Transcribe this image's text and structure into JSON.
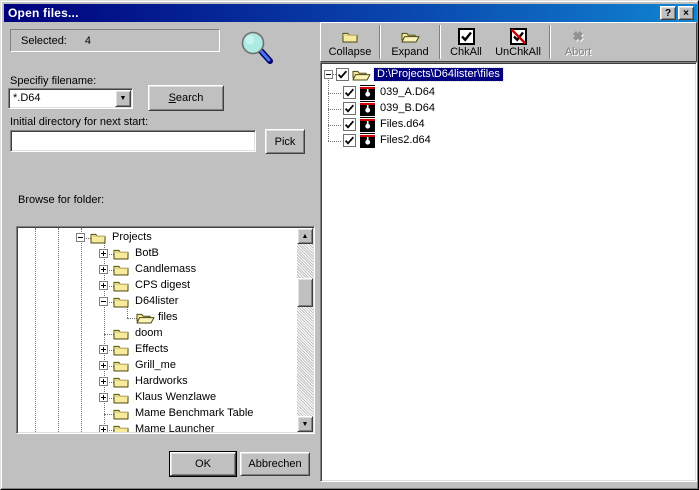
{
  "window": {
    "title": "Open files...",
    "help_button": "?",
    "close_button": "×"
  },
  "left": {
    "selected_label": "Selected:",
    "selected_value": "4",
    "filename_label": "Specifiy filename:",
    "filename_value": "*.D64",
    "search_button": "Search",
    "initial_dir_label": "Initial directory for next start:",
    "initial_dir_value": "",
    "pick_button": "Pick",
    "browse_label": "Browse for folder:",
    "ok_button": "OK",
    "cancel_button": "Abbrechen",
    "folder_tree": [
      {
        "label": "Projects",
        "indent": 2,
        "box": "minus",
        "icon": "folder-closed"
      },
      {
        "label": "BotB",
        "indent": 3,
        "box": "plus",
        "icon": "folder-closed"
      },
      {
        "label": "Candlemass",
        "indent": 3,
        "box": "plus",
        "icon": "folder-closed"
      },
      {
        "label": "CPS digest",
        "indent": 3,
        "box": "plus",
        "icon": "folder-closed"
      },
      {
        "label": "D64lister",
        "indent": 3,
        "box": "minus",
        "icon": "folder-closed"
      },
      {
        "label": "files",
        "indent": 4,
        "box": "none",
        "icon": "folder-open"
      },
      {
        "label": "doom",
        "indent": 3,
        "box": "none",
        "icon": "folder-closed"
      },
      {
        "label": "Effects",
        "indent": 3,
        "box": "plus",
        "icon": "folder-closed"
      },
      {
        "label": "Grill_me",
        "indent": 3,
        "box": "plus",
        "icon": "folder-closed"
      },
      {
        "label": "Hardworks",
        "indent": 3,
        "box": "plus",
        "icon": "folder-closed"
      },
      {
        "label": "Klaus Wenzlawe",
        "indent": 3,
        "box": "plus",
        "icon": "folder-closed"
      },
      {
        "label": "Mame Benchmark Table",
        "indent": 3,
        "box": "none",
        "icon": "folder-closed"
      },
      {
        "label": "Mame Launcher",
        "indent": 3,
        "box": "plus",
        "icon": "folder-closed"
      }
    ]
  },
  "right": {
    "toolbar": [
      {
        "label": "Collapse",
        "icon": "folder-closed",
        "enabled": true,
        "sep_after": true
      },
      {
        "label": "Expand",
        "icon": "folder-open",
        "enabled": true,
        "sep_after": true
      },
      {
        "label": "ChkAll",
        "icon": "check",
        "enabled": true,
        "sep_after": false
      },
      {
        "label": "UnChkAll",
        "icon": "uncheck",
        "enabled": true,
        "sep_after": true
      },
      {
        "label": "Abort",
        "icon": "abort",
        "enabled": false,
        "sep_after": false
      }
    ],
    "file_tree": {
      "root": {
        "label": "D:\\Projects\\D64lister\\files",
        "checked": true,
        "selected": true,
        "box": "minus",
        "icon": "folder-open"
      },
      "children": [
        {
          "label": "039_A.D64",
          "checked": true,
          "icon": "disk"
        },
        {
          "label": "039_B.D64",
          "checked": true,
          "icon": "disk"
        },
        {
          "label": "Files.d64",
          "checked": true,
          "icon": "disk"
        },
        {
          "label": "Files2.d64",
          "checked": true,
          "icon": "disk"
        }
      ]
    }
  },
  "colors": {
    "titlebar_left": "#00007c",
    "titlebar_right": "#1084d0",
    "selection": "#000080",
    "dialog_bg": "#c0c0c0",
    "folder_yellow": "#f7e99e",
    "check_red": "#cc0000"
  }
}
